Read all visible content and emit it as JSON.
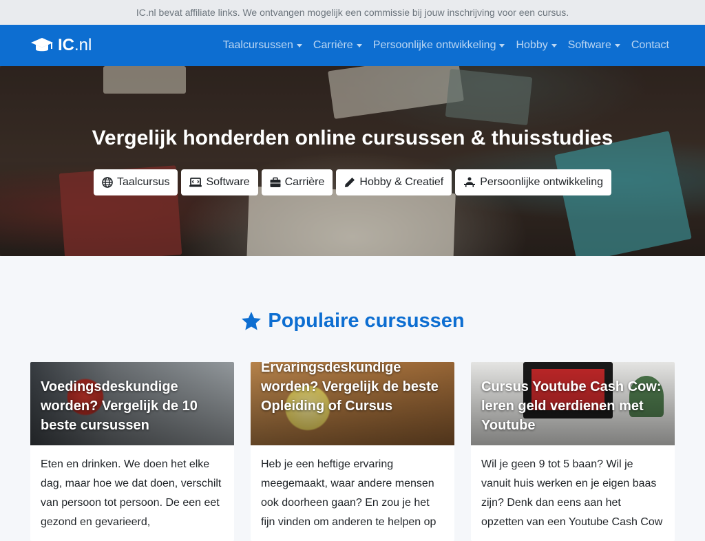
{
  "topbar": {
    "text": "IC.nl bevat affiliate links. We ontvangen mogelijk een commissie bij jouw inschrijving voor een cursus."
  },
  "brand": {
    "name_ic": "IC",
    "name_nl": ".nl"
  },
  "nav": {
    "items": [
      {
        "label": "Taalcursussen",
        "dropdown": true
      },
      {
        "label": "Carrière",
        "dropdown": true
      },
      {
        "label": "Persoonlijke ontwikkeling",
        "dropdown": true
      },
      {
        "label": "Hobby",
        "dropdown": true
      },
      {
        "label": "Software",
        "dropdown": true
      },
      {
        "label": "Contact",
        "dropdown": false
      }
    ]
  },
  "hero": {
    "title": "Vergelijk honderden online cursussen & thuisstudies",
    "buttons": [
      {
        "label": "Taalcursus",
        "icon": "globe-icon"
      },
      {
        "label": "Software",
        "icon": "laptop-code-icon"
      },
      {
        "label": "Carrière",
        "icon": "briefcase-icon"
      },
      {
        "label": "Hobby & Creatief",
        "icon": "pencil-icon"
      },
      {
        "label": "Persoonlijke ontwikkeling",
        "icon": "person-chalkboard-icon"
      }
    ]
  },
  "popular": {
    "title": "Populaire cursussen",
    "icon": "star-icon",
    "cards": [
      {
        "title": "Voedingsdeskundige worden? Vergelijk de 10 beste cursussen",
        "text": "Eten en drinken. We doen het elke dag, maar hoe we dat doen, verschilt van persoon tot persoon. De een eet gezond en gevarieerd,"
      },
      {
        "title": "Ervaringsdeskundige worden? Vergelijk de beste Opleiding of Cursus",
        "text": "Heb je een heftige ervaring meegemaakt, waar andere mensen ook doorheen gaan? En zou je het fijn vinden om anderen te helpen op"
      },
      {
        "title": "Cursus Youtube Cash Cow: leren geld verdienen met Youtube",
        "text": "Wil je geen 9 tot 5 baan? Wil je vanuit huis werken en je eigen baas zijn? Denk dan eens aan het opzetten van een Youtube Cash Cow"
      }
    ]
  },
  "colors": {
    "primary": "#0d6ed1",
    "topbar_bg": "#e9ebee",
    "page_bg": "#f5f7fa"
  }
}
